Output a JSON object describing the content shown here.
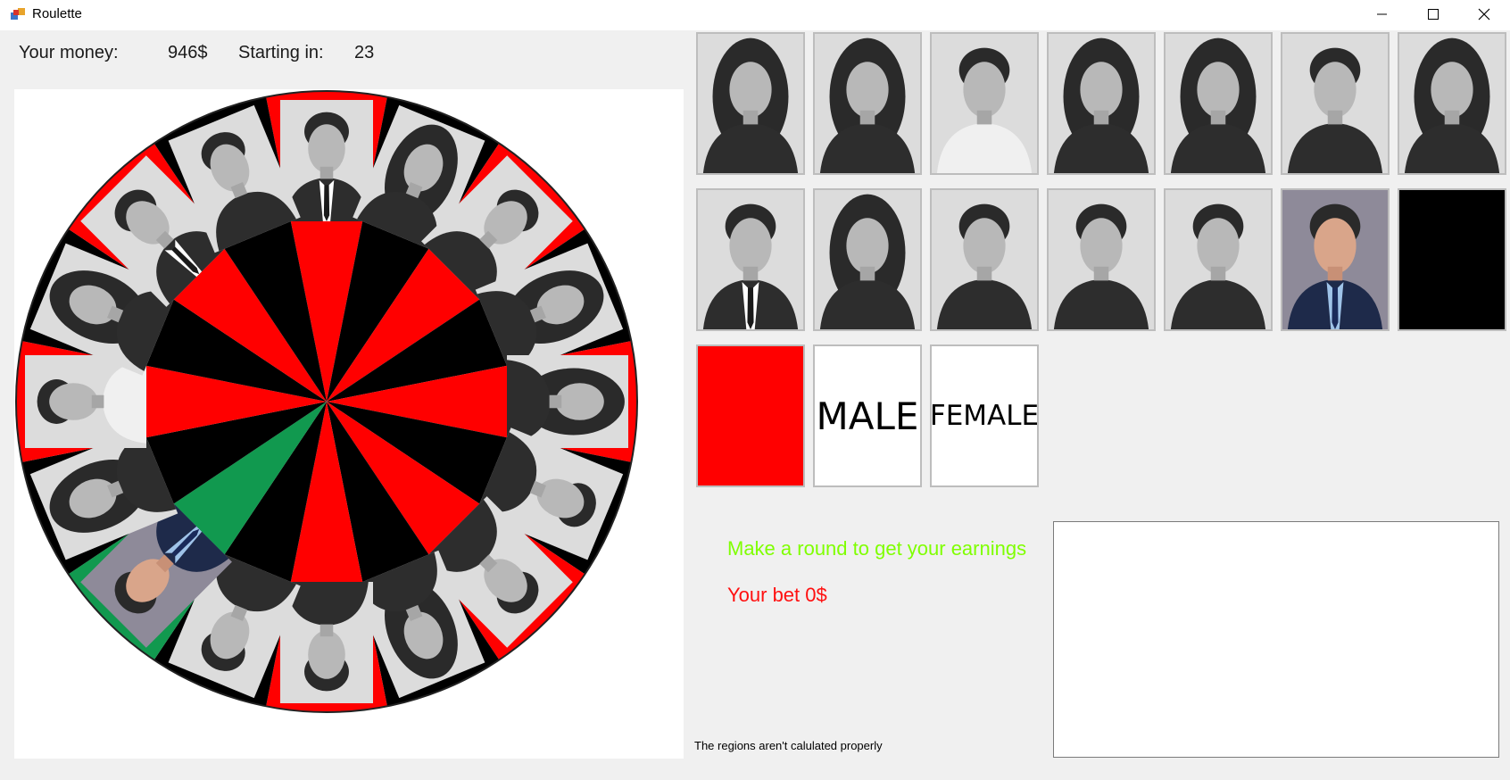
{
  "window": {
    "title": "Roulette",
    "icon": "roulette-app-icon",
    "controls": [
      "minimize-icon",
      "maximize-icon",
      "close-icon"
    ]
  },
  "header": {
    "money_label": "Your money:",
    "money_value": "946$",
    "countdown_label": "Starting in:",
    "countdown_value": "23"
  },
  "wheel": {
    "segments": [
      {
        "color": "#ff0000",
        "portrait": "man-suit-tie-goatee"
      },
      {
        "color": "#000000",
        "portrait": "woman-long-hair"
      },
      {
        "color": "#ff0000",
        "portrait": "man-smiling"
      },
      {
        "color": "#000000",
        "portrait": "woman-bangs"
      },
      {
        "color": "#ff0000",
        "portrait": "woman-long-hair-dark"
      },
      {
        "color": "#000000",
        "portrait": "man-dark-shirt"
      },
      {
        "color": "#ff0000",
        "portrait": "man-grey-hoodie"
      },
      {
        "color": "#000000",
        "portrait": "woman-scarf"
      },
      {
        "color": "#ff0000",
        "portrait": "man-black-shirt"
      },
      {
        "color": "#000000",
        "portrait": "man-sweater"
      },
      {
        "color": "#11994f",
        "portrait": "man-blue-suit-color"
      },
      {
        "color": "#000000",
        "portrait": "woman-portrait"
      },
      {
        "color": "#ff0000",
        "portrait": "man-white-shirt"
      },
      {
        "color": "#000000",
        "portrait": "woman-curly-hair"
      },
      {
        "color": "#ff0000",
        "portrait": "man-suit-tie"
      },
      {
        "color": "#000000",
        "portrait": "man-dark-shirt-2"
      }
    ]
  },
  "bets": {
    "row1": [
      "woman-long-hair",
      "woman-scarf",
      "man-white-shirt",
      "woman-dark-hair",
      "woman-bangs",
      "man-dark-shirt",
      "woman-long-hair-dark"
    ],
    "row2": [
      "man-suit-tie-goatee",
      "woman-curly-hair",
      "man-grey-hoodie",
      "man-black-shirt",
      "man-sweater",
      "man-blue-suit-color",
      "black-card"
    ],
    "row3": {
      "red_card": "red-card",
      "male_label": "MALE",
      "female_label": "FEMALE"
    }
  },
  "messages": {
    "earnings": "Make a round to get your earnings",
    "bet": "Your bet 0$",
    "note": "The regions aren't calulated properly"
  },
  "colors": {
    "red": "#ff0000",
    "black": "#000000",
    "green": "#11994f",
    "earnings_text": "#7fff00",
    "bet_text": "#ff1010"
  }
}
